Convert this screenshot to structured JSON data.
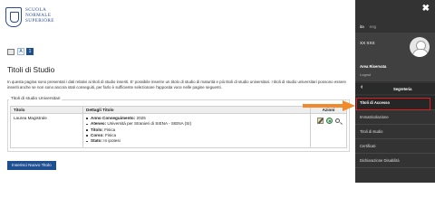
{
  "logo": {
    "lines": [
      "SCUOLA",
      "NORMALE",
      "SUPERIORE"
    ]
  },
  "steps": {
    "step1": "A",
    "step2": "1"
  },
  "page": {
    "title": "Titoli di Studio",
    "intro": "In questa pagina sono presentati i dati relativi ai titoli di studio inseriti. E' possibile inserire un titolo di studio di maturità e più titoli di studio universitari. I titoli di studio universitari possono essere inseriti anche se non sono ancora stati conseguiti, per farlo è sufficiente selezionare l'apposita voce nelle pagine seguenti.",
    "section_title": "Titoli di studio Universitari"
  },
  "table": {
    "headers": {
      "title": "Titolo",
      "details": "Dettagli Titolo",
      "actions": "Azioni"
    },
    "rows": [
      {
        "title": "Laurea Magistrale",
        "details": [
          {
            "label": "Anno Conseguimento:",
            "value": " 2025"
          },
          {
            "label": "Ateneo:",
            "value": " Università per Stranieri di SIENA - SIENA (SI)"
          },
          {
            "label": "Titolo:",
            "value": " Fisica"
          },
          {
            "label": "Corso:",
            "value": " Fisica"
          },
          {
            "label": "Stato:",
            "value": " In ipotesi"
          }
        ],
        "action_icons": [
          "edit-icon",
          "view-icon",
          "search-icon"
        ]
      }
    ]
  },
  "buttons": {
    "insert": "Inserisci Nuovo Titolo"
  },
  "sidebar": {
    "close": "✖",
    "lang": {
      "active": "ita",
      "other": "eng"
    },
    "user_name": "XX XXX",
    "area_title": "Area Riservata",
    "logout": "Logout",
    "section": "Segreteria",
    "back_icon": "chevron-left-icon",
    "items": [
      "Titoli di Accesso",
      "Immatricolazione",
      "Titoli di studio",
      "Certificati",
      "Dichiarazione Disabilità"
    ]
  },
  "colors": {
    "primary": "#1d4f91",
    "sidebar_bg": "#333333",
    "highlight": "#e02020",
    "arrow": "#f08a2c"
  }
}
